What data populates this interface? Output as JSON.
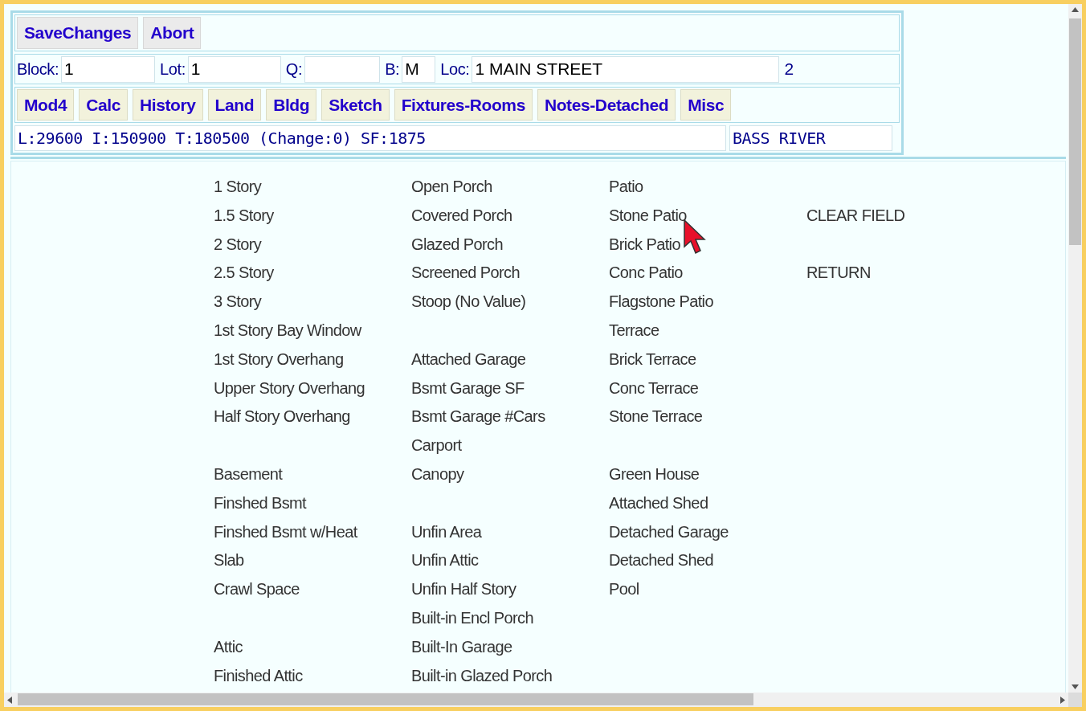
{
  "actions": [
    "SaveChanges",
    "Abort"
  ],
  "fields": [
    {
      "label": "Block:",
      "value": "1",
      "kind": "input"
    },
    {
      "label": "Lot:",
      "value": "1",
      "kind": "input"
    },
    {
      "label": "Q:",
      "kind": "input"
    },
    {
      "label": "B:",
      "value": "M",
      "kind": "input"
    },
    {
      "label": "Loc:",
      "value": "1 MAIN STREET",
      "kind": "input"
    },
    {
      "value": "2",
      "kind": "text"
    }
  ],
  "nav": [
    "Mod4",
    "Calc",
    "History",
    "Land",
    "Bldg",
    "Sketch",
    "Fixtures-Rooms",
    "Notes-Detached",
    "Misc"
  ],
  "summary": "L:29600 I:150900 T:180500 (Change:0) SF:1875",
  "area": "BASS RIVER",
  "grid_rows": [
    {
      "column_1": "1 Story",
      "column_2": "Open Porch",
      "column_3": "Patio"
    },
    {
      "column_1": "1.5 Story",
      "column_2": "Covered Porch",
      "column_3": "Stone Patio",
      "column_4": "CLEAR FIELD"
    },
    {
      "column_1": "2 Story",
      "column_2": "Glazed Porch",
      "column_3": "Brick Patio"
    },
    {
      "column_1": "2.5 Story",
      "column_2": "Screened Porch",
      "column_3": "Conc Patio",
      "column_4": "RETURN"
    },
    {
      "column_1": "3 Story",
      "column_2": "Stoop (No Value)",
      "column_3": "Flagstone Patio"
    },
    {
      "column_1": "1st Story Bay Window",
      "column_3": "Terrace"
    },
    {
      "column_1": "1st Story Overhang",
      "column_2": "Attached Garage",
      "column_3": "Brick Terrace"
    },
    {
      "column_1": "Upper Story Overhang",
      "column_2": "Bsmt Garage SF",
      "column_3": "Conc Terrace"
    },
    {
      "column_1": "Half Story Overhang",
      "column_2": "Bsmt Garage #Cars",
      "column_3": "Stone Terrace"
    },
    {
      "column_2": "Carport"
    },
    {
      "column_1": "Basement",
      "column_2": "Canopy",
      "column_3": "Green House"
    },
    {
      "column_1": "Finshed Bsmt",
      "column_3": "Attached Shed"
    },
    {
      "column_1": "Finshed Bsmt w/Heat",
      "column_2": "Unfin Area",
      "column_3": "Detached Garage"
    },
    {
      "column_1": "Slab",
      "column_2": "Unfin Attic",
      "column_3": "Detached Shed"
    },
    {
      "column_1": "Crawl Space",
      "column_2": "Unfin Half Story",
      "column_3": "Pool"
    },
    {
      "column_2": "Built-in Encl Porch"
    },
    {
      "column_1": "Attic",
      "column_2": "Built-In Garage"
    },
    {
      "column_1": "Finished Attic",
      "column_2": "Built-in Glazed Porch"
    }
  ]
}
